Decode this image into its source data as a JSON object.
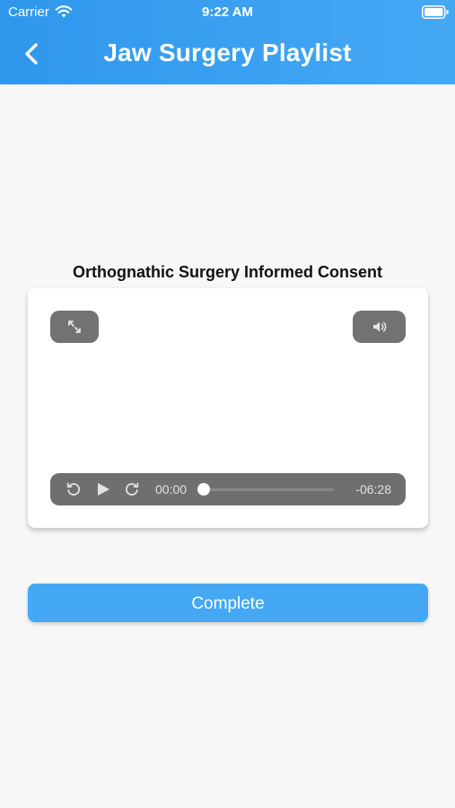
{
  "status_bar": {
    "carrier": "Carrier",
    "time": "9:22 AM"
  },
  "header": {
    "title": "Jaw Surgery Playlist",
    "back_icon": "chevron-left-icon"
  },
  "video": {
    "title": "Orthognathic Surgery Informed Consent",
    "elapsed": "00:00",
    "remaining": "-06:28",
    "progress": 0,
    "icons": {
      "fullscreen": "expand-icon",
      "volume": "speaker-icon",
      "rewind": "rewind-icon",
      "play": "play-icon",
      "forward": "forward-icon"
    }
  },
  "actions": {
    "complete_label": "Complete"
  },
  "colors": {
    "header": "#3aa0f0",
    "button": "#45a8f5",
    "controls": "#727272",
    "background": "#f7f7f7"
  }
}
